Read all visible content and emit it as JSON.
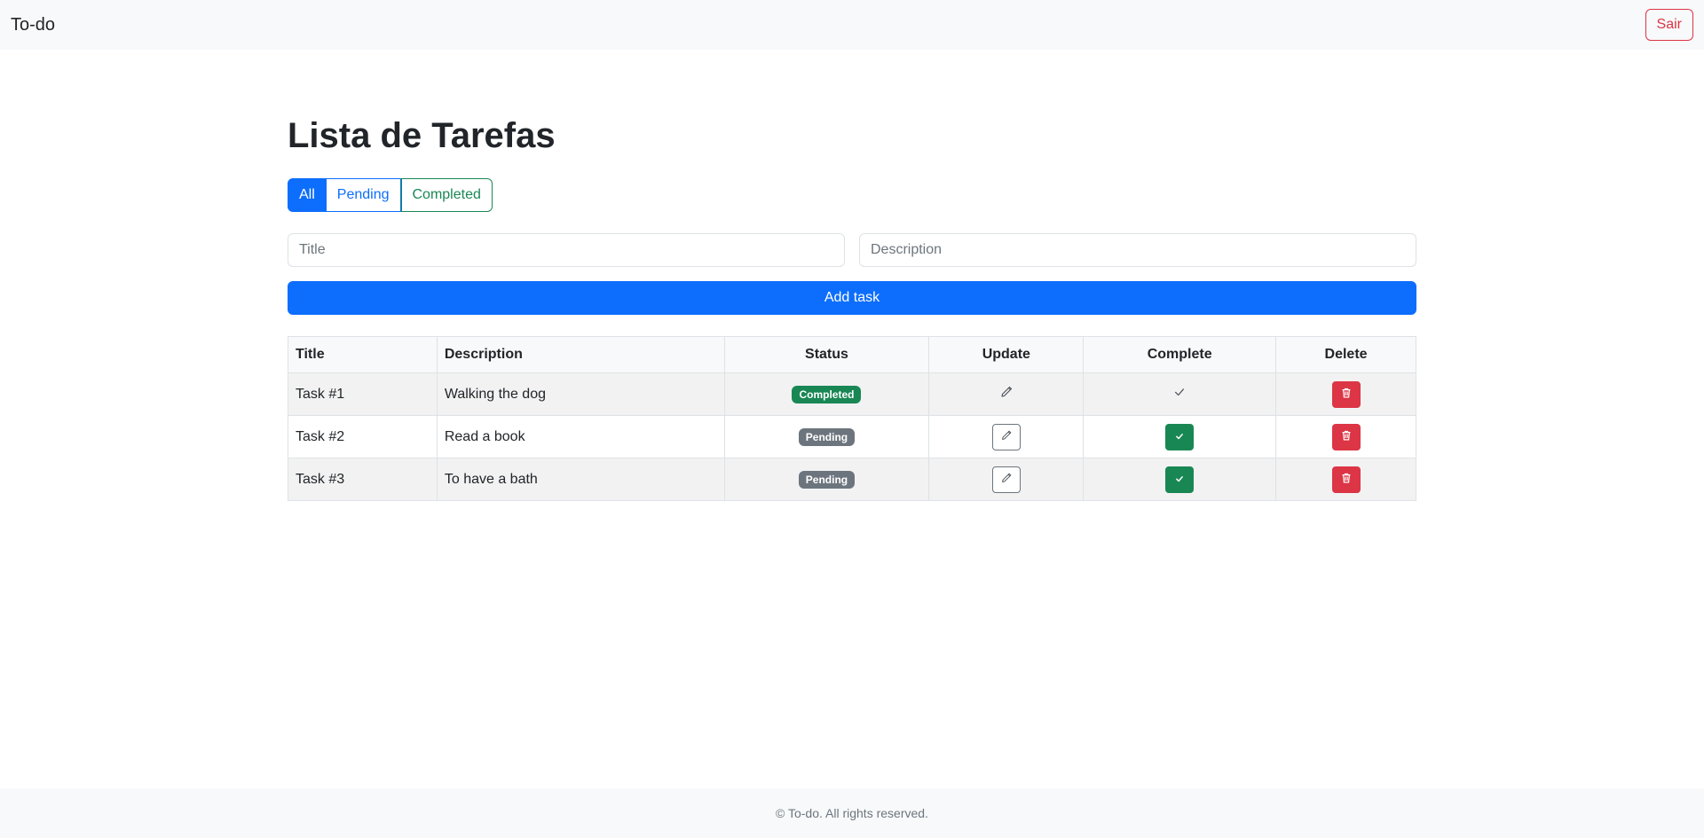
{
  "navbar": {
    "brand": "To-do",
    "logout_label": "Sair"
  },
  "page": {
    "title": "Lista de Tarefas"
  },
  "filters": {
    "all": "All",
    "pending": "Pending",
    "completed": "Completed",
    "selected": "All"
  },
  "form": {
    "title_placeholder": "Title",
    "description_placeholder": "Description",
    "title_value": "",
    "description_value": "",
    "add_label": "Add task"
  },
  "table": {
    "headers": {
      "title": "Title",
      "description": "Description",
      "status": "Status",
      "update": "Update",
      "complete": "Complete",
      "delete": "Delete"
    },
    "rows": [
      {
        "title": "Task #1",
        "description": "Walking the dog",
        "status": "Completed"
      },
      {
        "title": "Task #2",
        "description": "Read a book",
        "status": "Pending"
      },
      {
        "title": "Task #3",
        "description": "To have a bath",
        "status": "Pending"
      }
    ]
  },
  "icons": {
    "edit": "pencil-icon",
    "complete": "check-icon",
    "delete": "trash-icon"
  },
  "colors": {
    "primary": "#0d6efd",
    "success": "#198754",
    "danger": "#dc3545",
    "secondary": "#6c757d"
  },
  "footer": {
    "text": "© To-do. All rights reserved."
  }
}
